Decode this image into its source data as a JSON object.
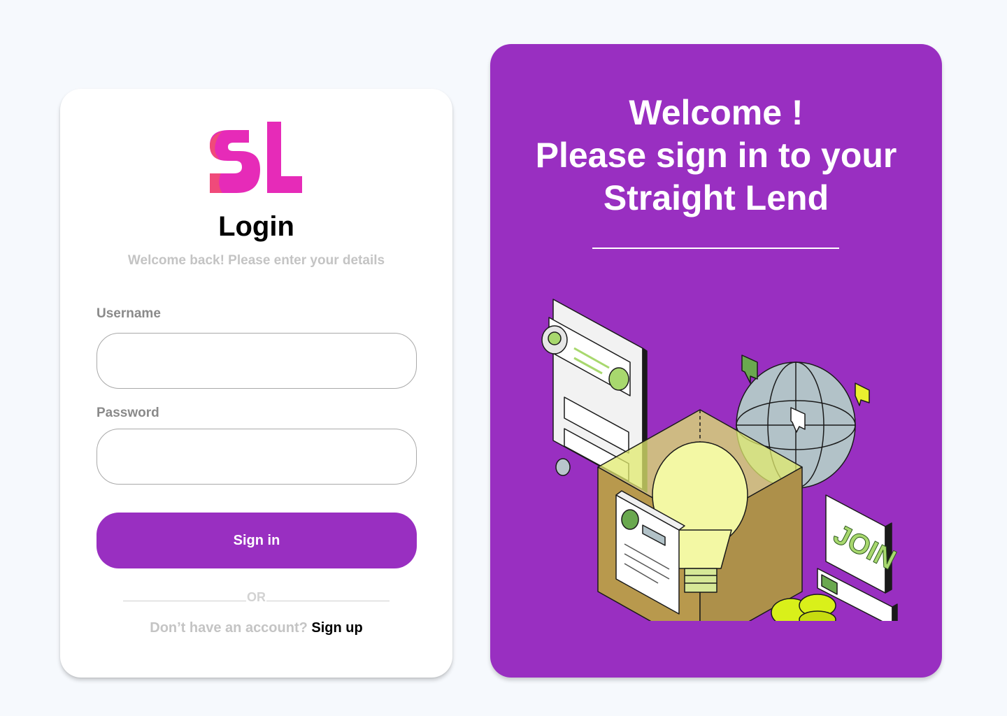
{
  "brand": {
    "logo_text": "SL",
    "primary_color": "#992fc1",
    "logo_color": "#e62bb8"
  },
  "login": {
    "title": "Login",
    "subtitle": "Welcome back! Please enter your details",
    "username_label": "Username",
    "username_value": "",
    "password_label": "Password",
    "password_value": "",
    "signin_label": "Sign in",
    "or_text": "OR",
    "signup_prompt": "Don’t have an account?",
    "signup_link": "Sign up"
  },
  "promo": {
    "line1": "Welcome !",
    "line2": "Please sign in to your",
    "line3": "Straight Lend",
    "illustration": {
      "join_sign_text": "JOIN",
      "icons": [
        "profile-card-icon",
        "globe-icon",
        "lightbulb-icon",
        "info-document-icon",
        "coin-stack-icon",
        "chat-bubble-icon",
        "progress-bar-icon"
      ]
    }
  }
}
